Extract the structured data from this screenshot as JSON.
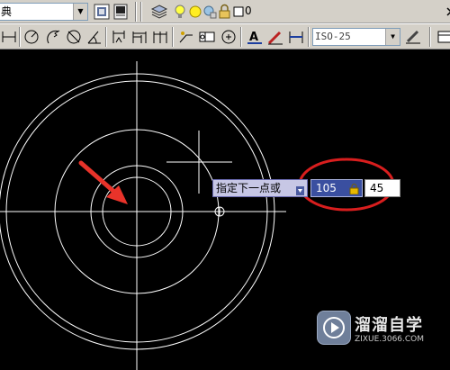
{
  "toolbar_top": {
    "style_combo_text": "典",
    "layer_combo_text": "0"
  },
  "toolbar_second": {
    "dimstyle_combo_text": "ISO-25"
  },
  "dynamic_input": {
    "prompt": "指定下一点或",
    "length_value": "105",
    "angle_value": "45"
  },
  "watermark": {
    "title": "溜溜自学",
    "url": "ZIXUE.3066.COM"
  },
  "colors": {
    "canvas_bg": "#000000",
    "geometry": "#ffffff",
    "highlight_ellipse": "#d81e1e",
    "arrow": "#e8332a",
    "toolbar_bg": "#d4d0c8",
    "tooltip_bg": "#c7c7e5",
    "value_box_active": "#3a4fa0"
  },
  "icons": [
    "preview-icon",
    "publish-icon",
    "layers-icon",
    "bulb-icon",
    "sun-icon",
    "lock-icon",
    "color-square-icon",
    "dim-linear-icon",
    "dim-radius-icon",
    "dim-angular-icon",
    "tolerance-icon",
    "center-mark-icon",
    "text-style-icon",
    "dim-edit-icon",
    "dim-update-icon",
    "dim-style-icon"
  ]
}
